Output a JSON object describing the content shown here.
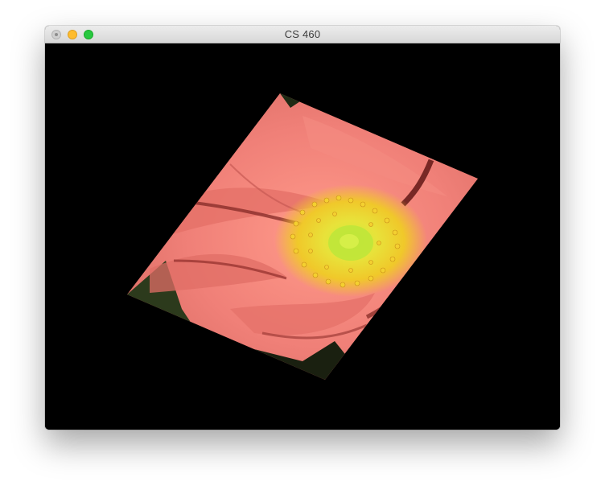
{
  "window": {
    "title": "CS 460",
    "buttons": [
      {
        "name": "close",
        "icon": "close-icon",
        "color": "#d0d0d0"
      },
      {
        "name": "minimize",
        "icon": "minimize-icon",
        "color": "#febc2e"
      },
      {
        "name": "zoom",
        "icon": "zoom-icon",
        "color": "#28c840"
      }
    ]
  },
  "canvas": {
    "background": "#000000",
    "image": {
      "subject": "flower-image",
      "colors": {
        "petal": "#f08078",
        "petal_shadow": "#b54c48",
        "stamen": "#f2d22c",
        "center": "#bfe63a",
        "leaf": "#2c3a1c"
      }
    }
  }
}
